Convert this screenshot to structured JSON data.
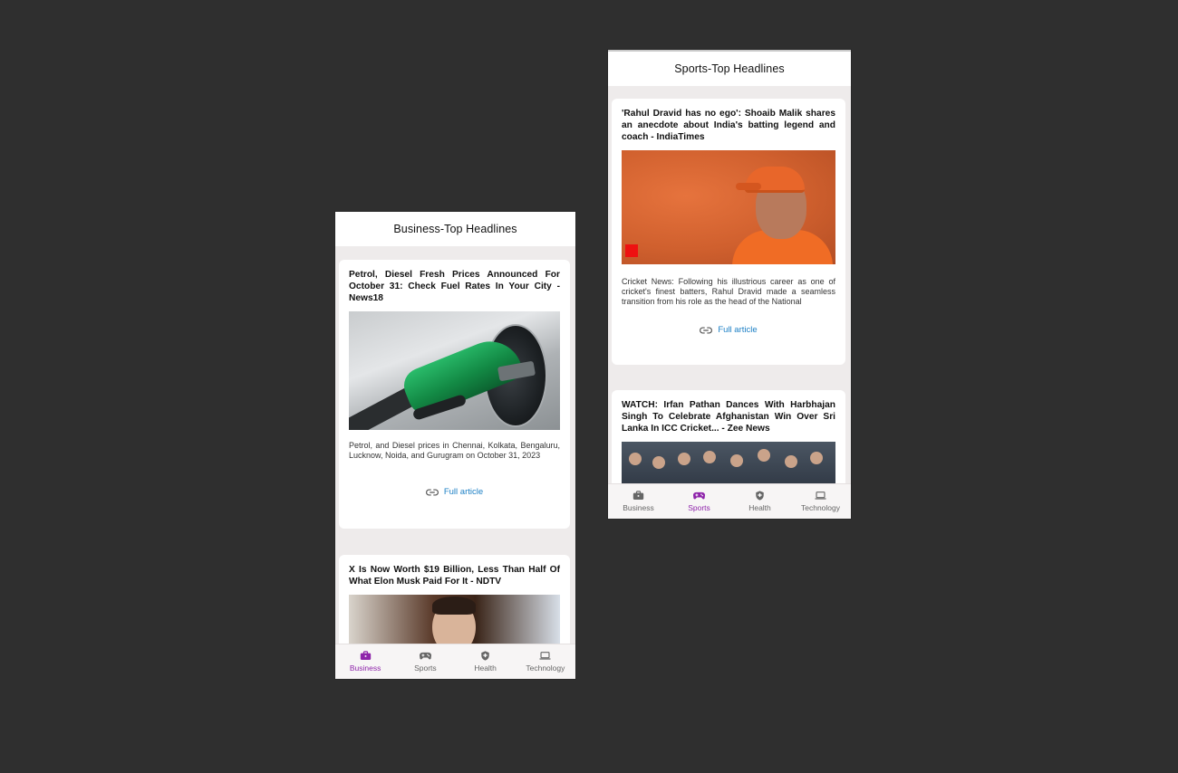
{
  "business": {
    "title": "Business-Top Headlines",
    "articles": [
      {
        "title": "Petrol, Diesel Fresh Prices Announced For October 31: Check Fuel Rates In Your City - News18",
        "description": "Petrol, and Diesel prices in Chennai, Kolkata, Bengaluru, Lucknow, Noida, and Gurugram on October 31, 2023",
        "link_label": "Full article"
      },
      {
        "title": "X Is Now Worth $19 Billion, Less Than Half Of What Elon Musk Paid For It - NDTV"
      }
    ]
  },
  "sports": {
    "title": "Sports-Top Headlines",
    "articles": [
      {
        "title": "'Rahul Dravid has no ego': Shoaib Malik shares an anecdote about India's batting legend and coach - IndiaTimes",
        "description": "Cricket News: Following his illustrious career as one of cricket's finest batters, Rahul Dravid made a seamless transition from his role as the head of the National",
        "link_label": "Full article"
      },
      {
        "title": "WATCH: Irfan Pathan Dances With Harbhajan Singh To Celebrate Afghanistan Win Over Sri Lanka In ICC Cricket... - Zee News"
      }
    ]
  },
  "nav": {
    "items": [
      {
        "label": "Business",
        "icon": "briefcase-icon"
      },
      {
        "label": "Sports",
        "icon": "gamepad-icon"
      },
      {
        "label": "Health",
        "icon": "health-shield-icon"
      },
      {
        "label": "Technology",
        "icon": "laptop-icon"
      }
    ]
  },
  "colors": {
    "accent": "#8e24aa",
    "link": "#1b7fc5",
    "background": "#2f2f2f"
  }
}
